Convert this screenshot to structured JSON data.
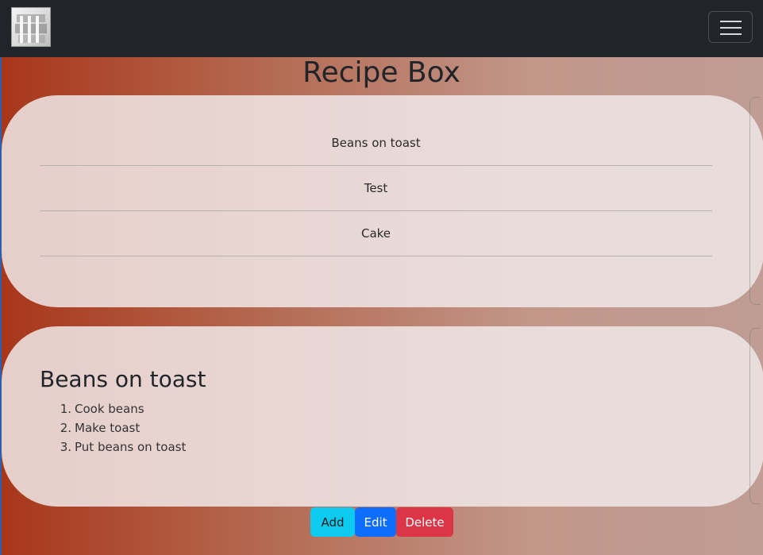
{
  "navbar": {
    "logo_icon": "letters-logo-icon",
    "toggler_icon": "hamburger-menu-icon"
  },
  "page": {
    "title": "Recipe Box"
  },
  "recipes": {
    "items": [
      {
        "label": "Beans on toast"
      },
      {
        "label": "Test"
      },
      {
        "label": "Cake"
      }
    ]
  },
  "selected": {
    "title": "Beans on toast",
    "steps": [
      {
        "num": "1.",
        "text": "Cook beans"
      },
      {
        "num": "2.",
        "text": "Make toast"
      },
      {
        "num": "3.",
        "text": "Put beans on toast"
      }
    ]
  },
  "actions": {
    "add_label": "Add",
    "edit_label": "Edit",
    "delete_label": "Delete"
  },
  "colors": {
    "navbar": "#212529",
    "add": "#0dcaf0",
    "edit": "#0d6efd",
    "delete": "#dc3545"
  }
}
